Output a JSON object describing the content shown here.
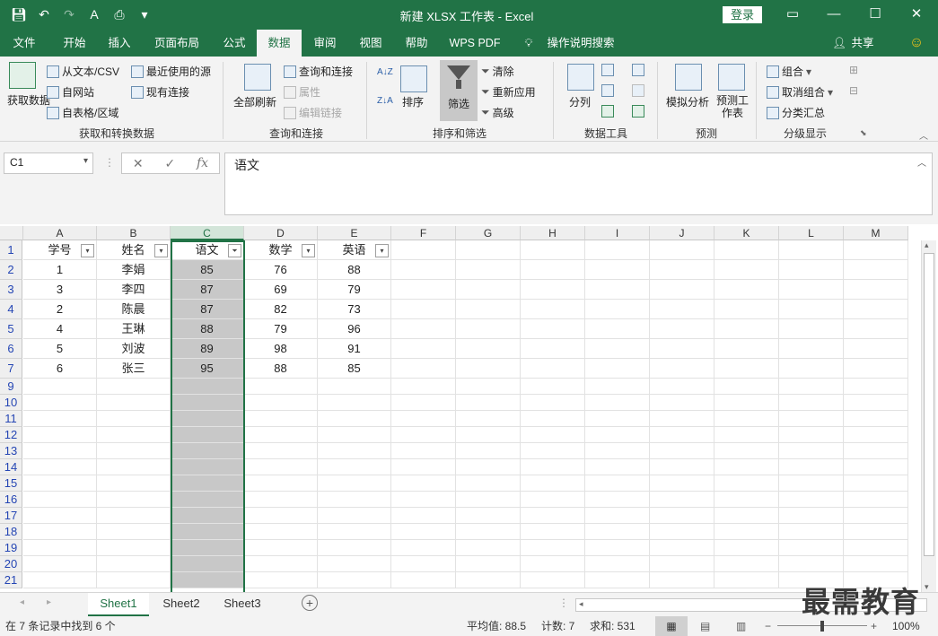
{
  "window": {
    "title": "新建 XLSX 工作表  -  Excel",
    "login": "登录"
  },
  "menu": {
    "tabs": [
      "文件",
      "开始",
      "插入",
      "页面布局",
      "公式",
      "数据",
      "审阅",
      "视图",
      "帮助",
      "WPS PDF"
    ],
    "tell_me": "操作说明搜索",
    "share": "共享"
  },
  "ribbon": {
    "get_data": {
      "label": "获取数据",
      "from_text": "从文本/CSV",
      "from_web": "自网站",
      "from_table": "自表格/区域",
      "recent": "最近使用的源",
      "existing": "现有连接",
      "group": "获取和转换数据"
    },
    "queries": {
      "refresh_all": "全部刷新",
      "queries": "查询和连接",
      "properties": "属性",
      "edit_links": "编辑链接",
      "group": "查询和连接"
    },
    "sort": {
      "sort": "排序",
      "filter": "筛选",
      "clear": "清除",
      "reapply": "重新应用",
      "advanced": "高级",
      "group": "排序和筛选"
    },
    "tools": {
      "split": "分列",
      "group": "数据工具"
    },
    "forecast": {
      "whatif": "模拟分析",
      "sheet": "预测工作表",
      "group": "预测"
    },
    "outline": {
      "group_btn": "组合",
      "ungroup": "取消组合",
      "subtotal": "分类汇总",
      "group": "分级显示"
    }
  },
  "formula_bar": {
    "name_box": "C1",
    "content": "语文"
  },
  "columns": [
    "A",
    "B",
    "C",
    "D",
    "E",
    "F",
    "G",
    "H",
    "I",
    "J",
    "K",
    "L",
    "M"
  ],
  "headers": [
    "学号",
    "姓名",
    "语文",
    "数学",
    "英语"
  ],
  "rows": [
    [
      "1",
      "李娟",
      "85",
      "76",
      "88"
    ],
    [
      "3",
      "李四",
      "87",
      "69",
      "79"
    ],
    [
      "2",
      "陈晨",
      "87",
      "82",
      "73"
    ],
    [
      "4",
      "王琳",
      "88",
      "79",
      "96"
    ],
    [
      "5",
      "刘波",
      "89",
      "98",
      "91"
    ],
    [
      "6",
      "张三",
      "95",
      "88",
      "85"
    ]
  ],
  "row_numbers": [
    "1",
    "2",
    "3",
    "4",
    "5",
    "6",
    "7",
    "9",
    "10",
    "11",
    "12",
    "13",
    "14",
    "15",
    "16",
    "17",
    "18",
    "19",
    "20",
    "21"
  ],
  "sheets": [
    "Sheet1",
    "Sheet2",
    "Sheet3"
  ],
  "status": {
    "left": "在 7 条记录中找到 6 个",
    "average": "平均值: 88.5",
    "count": "计数: 7",
    "sum": "求和: 531",
    "zoom": "100%"
  },
  "watermark": "最需教育"
}
